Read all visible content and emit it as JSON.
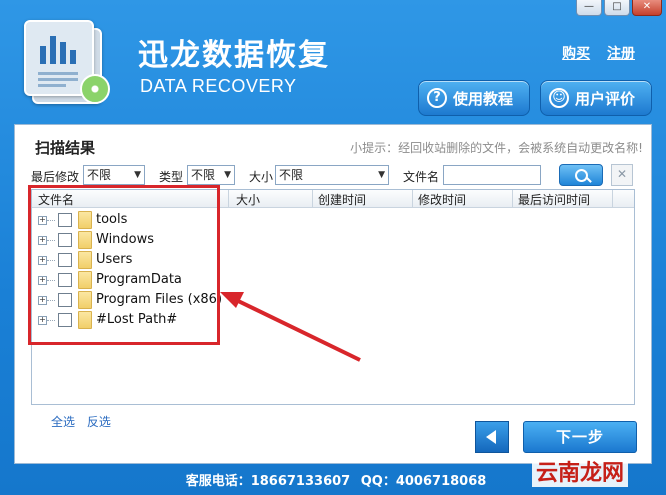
{
  "window": {
    "minimize": "—",
    "maximize": "□",
    "close": "✕"
  },
  "brand": {
    "cn": "迅龙数据恢复",
    "en": "DATA RECOVERY"
  },
  "top_links": {
    "buy": "购买",
    "register": "注册"
  },
  "header_buttons": {
    "help": "使用教程",
    "review": "用户评价"
  },
  "panel": {
    "title": "扫描结果",
    "tip": "小提示：经回收站删除的文件，会被系统自动更改名称!"
  },
  "filters": {
    "modified_label": "最后修改",
    "modified_value": "不限",
    "type_label": "类型",
    "type_value": "不限",
    "size_label": "大小",
    "size_value": "不限",
    "filename_label": "文件名",
    "filename_value": "",
    "clear": "✕"
  },
  "grid": {
    "headers": [
      "文件名",
      "大小",
      "创建时间",
      "修改时间",
      "最后访问时间"
    ],
    "rows": [
      {
        "expander": "+",
        "name": "tools"
      },
      {
        "expander": "+",
        "name": "Windows"
      },
      {
        "expander": "+",
        "name": "Users"
      },
      {
        "expander": "+",
        "name": "ProgramData"
      },
      {
        "expander": "+",
        "name": "Program Files (x86)"
      },
      {
        "expander": "+",
        "name": "#Lost Path#"
      }
    ]
  },
  "selection": {
    "select_all": "全选",
    "invert": "反选"
  },
  "nav": {
    "next": "下一步"
  },
  "footer": {
    "phone_label": "客服电话：",
    "phone": "18667133607",
    "qq_label": "QQ：",
    "qq": "4006718068"
  },
  "watermark": "云南龙网",
  "colors": {
    "accent": "#1a80d6",
    "annotation": "#d8262b"
  }
}
